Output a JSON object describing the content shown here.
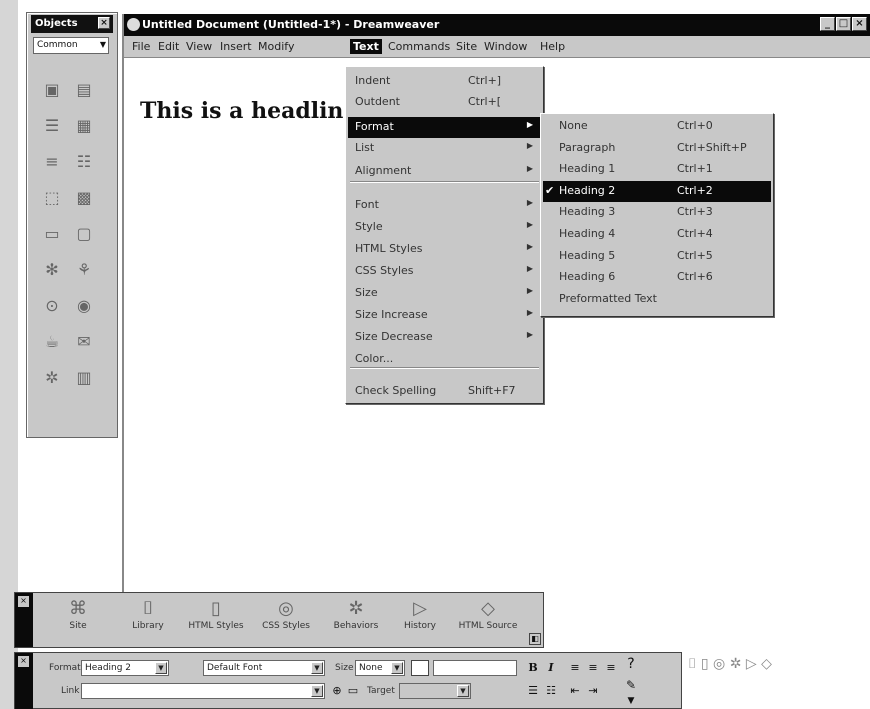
{
  "objects_panel": {
    "title": "Objects",
    "category": "Common",
    "icons": [
      "image-icon",
      "rollover-icon",
      "table-icon",
      "tabular-data-icon",
      "hr-icon",
      "navbar-icon",
      "layer-icon",
      "frames-icon",
      "form-icon",
      "fireworks-html-icon",
      "flash-icon",
      "shockwave-icon",
      "java-icon",
      "plugin-icon",
      "email-icon",
      "server-icon",
      "sitemap-icon",
      "date-icon"
    ]
  },
  "window": {
    "title": "Untitled Document (Untitled-1*) - Dreamweaver",
    "menus": [
      "File",
      "Edit",
      "View",
      "Insert",
      "Modify",
      "Text",
      "Commands",
      "Site",
      "Window",
      "Help"
    ],
    "active_menu": "Text"
  },
  "document": {
    "heading": "This is a headlin"
  },
  "text_menu": {
    "items": [
      {
        "label": "Indent",
        "shortcut": "Ctrl+]"
      },
      {
        "label": "Outdent",
        "shortcut": "Ctrl+["
      },
      {
        "label": "Format",
        "submenu": true,
        "highlighted": true
      },
      {
        "label": "List",
        "submenu": true
      },
      {
        "label": "Alignment",
        "submenu": true
      },
      {
        "label": "Font",
        "submenu": true
      },
      {
        "label": "Style",
        "submenu": true
      },
      {
        "label": "HTML Styles",
        "submenu": true
      },
      {
        "label": "CSS Styles",
        "submenu": true
      },
      {
        "label": "Size",
        "submenu": true
      },
      {
        "label": "Size Increase",
        "submenu": true
      },
      {
        "label": "Size Decrease",
        "submenu": true
      },
      {
        "label": "Color..."
      },
      {
        "label": "Check Spelling",
        "shortcut": "Shift+F7"
      }
    ]
  },
  "format_menu": {
    "items": [
      {
        "label": "None",
        "shortcut": "Ctrl+0"
      },
      {
        "label": "Paragraph",
        "shortcut": "Ctrl+Shift+P"
      },
      {
        "label": "Heading 1",
        "shortcut": "Ctrl+1"
      },
      {
        "label": "Heading 2",
        "shortcut": "Ctrl+2",
        "checked": true,
        "highlighted": true
      },
      {
        "label": "Heading 3",
        "shortcut": "Ctrl+3"
      },
      {
        "label": "Heading 4",
        "shortcut": "Ctrl+4"
      },
      {
        "label": "Heading 5",
        "shortcut": "Ctrl+5"
      },
      {
        "label": "Heading 6",
        "shortcut": "Ctrl+6"
      },
      {
        "label": "Preformatted Text"
      }
    ]
  },
  "launcher": {
    "buttons": [
      {
        "label": "Site",
        "icon": "site-icon"
      },
      {
        "label": "Library",
        "icon": "library-icon"
      },
      {
        "label": "HTML Styles",
        "icon": "html-styles-icon"
      },
      {
        "label": "CSS Styles",
        "icon": "css-styles-icon"
      },
      {
        "label": "Behaviors",
        "icon": "behaviors-icon"
      },
      {
        "label": "History",
        "icon": "history-icon"
      },
      {
        "label": "HTML Source",
        "icon": "html-source-icon"
      }
    ]
  },
  "properties": {
    "format_label": "Format",
    "format_value": "Heading 2",
    "font_value": "Default Font",
    "size_label": "Size",
    "size_value": "None",
    "link_label": "Link",
    "link_value": "",
    "target_label": "Target",
    "target_value": "",
    "bold_label": "B",
    "italic_label": "I"
  },
  "colors": {
    "titlebar": "#0a0a0a",
    "chrome": "#c8c8c8",
    "highlight": "#0a0a0a"
  }
}
